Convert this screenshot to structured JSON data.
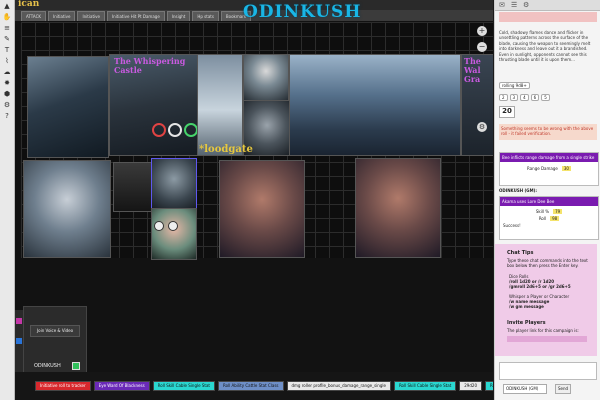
{
  "map_title": "ODINKUSH",
  "corner_text": "ican",
  "top_macros": [
    "ATTACK",
    "Initiative",
    "Initiative",
    "Initiative Hit Pt Damage",
    "Insight",
    "Hp stats",
    "Bookmark"
  ],
  "image_titles": {
    "whispering": "The Whispering Castle",
    "bloodgate": "*loodgate",
    "right_edge": "The Wal Gra"
  },
  "bottom_macros": [
    {
      "label": "Initiative roll to tracker",
      "color": "#d8282d",
      "text_color": "#ffffff"
    },
    {
      "label": "Eye Ward Of Blackness",
      "color": "#6a2ab8",
      "text_color": "#ffffff"
    },
    {
      "label": "Roll Skill Cable Single Stat",
      "color": "#2ad7d0",
      "text_color": "#111111"
    },
    {
      "label": "Roll Ability Cattle Stat Class",
      "color": "#6e8fc7",
      "text_color": "#111111"
    },
    {
      "label": "dmg roller profile_bonus_damage_range_single",
      "color": "#e9e9e9",
      "text_color": "#111111"
    },
    {
      "label": "Roll Skill Cable Single Stat",
      "color": "#2ad7d0",
      "text_color": "#111111"
    },
    {
      "label": "29d20",
      "color": "#e9e9e9",
      "text_color": "#111111"
    },
    {
      "label": "Roll Skill Cable Single Stat",
      "color": "#2ad7d0",
      "text_color": "#111111"
    }
  ],
  "video": {
    "join_label": "Join Voice & Video",
    "name": "ODINKUSH"
  },
  "chat": {
    "description": "Cold, shadowy flames dance and flicker in unsettling patterns across the surface of the blade, causing the weapon to seemingly melt into darkness and leave out it a brandished. Even in sunlight, opponents cannot see this thrusting blade until it is upon them...",
    "rolling_label": "rolling 9d8+",
    "dice": [
      "2",
      "3",
      "4",
      "6",
      "5"
    ],
    "total": "20",
    "error_line": "Something seems to be wrong with the above roll - it failed verification.",
    "card_header": "Bee inflicts range damage from a single strike",
    "card_row_label": "Range Damage",
    "card_row_value": "30",
    "speaker": "ODINKUSH (GM):",
    "card2_header": "Akama uses Lore Dee Bee",
    "skill_label": "Skill %",
    "skill_value": "79",
    "roll_label": "Roll",
    "roll_value": "98",
    "result_label": "Success!"
  },
  "tips": {
    "title": "Chat Tips",
    "intro": "Type these chat commands into the text box below then press the Enter key.",
    "item1_label": "Dice Rolls",
    "item1_line1": "/roll 1d20 or /r 1d20",
    "item1_line2": "/gmroll 2d6+5 or /gr 2d6+5",
    "item2_label": "Whisper a Player or Character",
    "item2_line1": "/w name message",
    "item2_line2": "/w gm message"
  },
  "invite": {
    "title": "Invite Players",
    "text": "The player link for this campaign is:"
  },
  "chat_footer": {
    "speaker_select": "ODINKUSH (GM)",
    "send_label": "Send"
  },
  "colors": {
    "accent_purple": "#7a1bb0",
    "map_title": "#19b6e6",
    "tips_panel": "#f0cbe8",
    "selection": "#5f58f0"
  }
}
